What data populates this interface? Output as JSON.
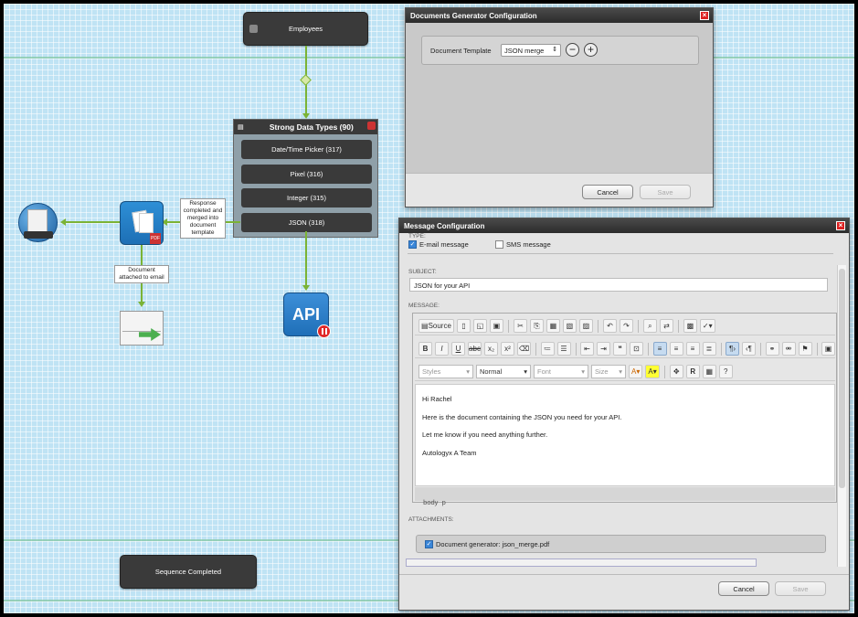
{
  "workflow": {
    "employees_label": "Employees",
    "group": {
      "title": "Strong Data Types (90)",
      "items": [
        {
          "label": "Date/Time Picker (317)"
        },
        {
          "label": "Pixel (316)"
        },
        {
          "label": "Integer (315)"
        },
        {
          "label": "JSON (318)"
        }
      ]
    },
    "merge_label": "Response completed and merged into document template",
    "attach_label": "Document attached to email",
    "sequence_label": "Sequence Completed",
    "api_label": "API"
  },
  "doc_gen_window": {
    "title": "Documents Generator Configuration",
    "template_label": "Document Template",
    "template_value": "JSON merge",
    "cancel_label": "Cancel",
    "save_label": "Save"
  },
  "message_window": {
    "title": "Message Configuration",
    "type_caption": "TYPE:",
    "email_label": "E-mail message",
    "sms_label": "SMS message",
    "subject_caption": "SUBJECT:",
    "subject_value": "JSON for your API",
    "message_caption": "MESSAGE:",
    "editor": {
      "source_label": "Source",
      "styles_placeholder": "Styles",
      "format_value": "Normal",
      "font_placeholder": "Font",
      "size_placeholder": "Size",
      "body_lines": [
        "Hi Rachel",
        "Here is the document containing the JSON you need for your API.",
        "Let me know if you need anything further.",
        "Autologyx A Team"
      ],
      "status_path": "body  p"
    },
    "attachments_caption": "ATTACHMENTS:",
    "attachment_label": "Document generator: json_merge.pdf",
    "cancel_label": "Cancel",
    "save_label": "Save"
  },
  "colors": {
    "canvas": "#bfe3f4",
    "connector": "#7bb335",
    "node": "#3a3a3a",
    "api_blue": "#1f6fb8",
    "close_red": "#d22222"
  }
}
